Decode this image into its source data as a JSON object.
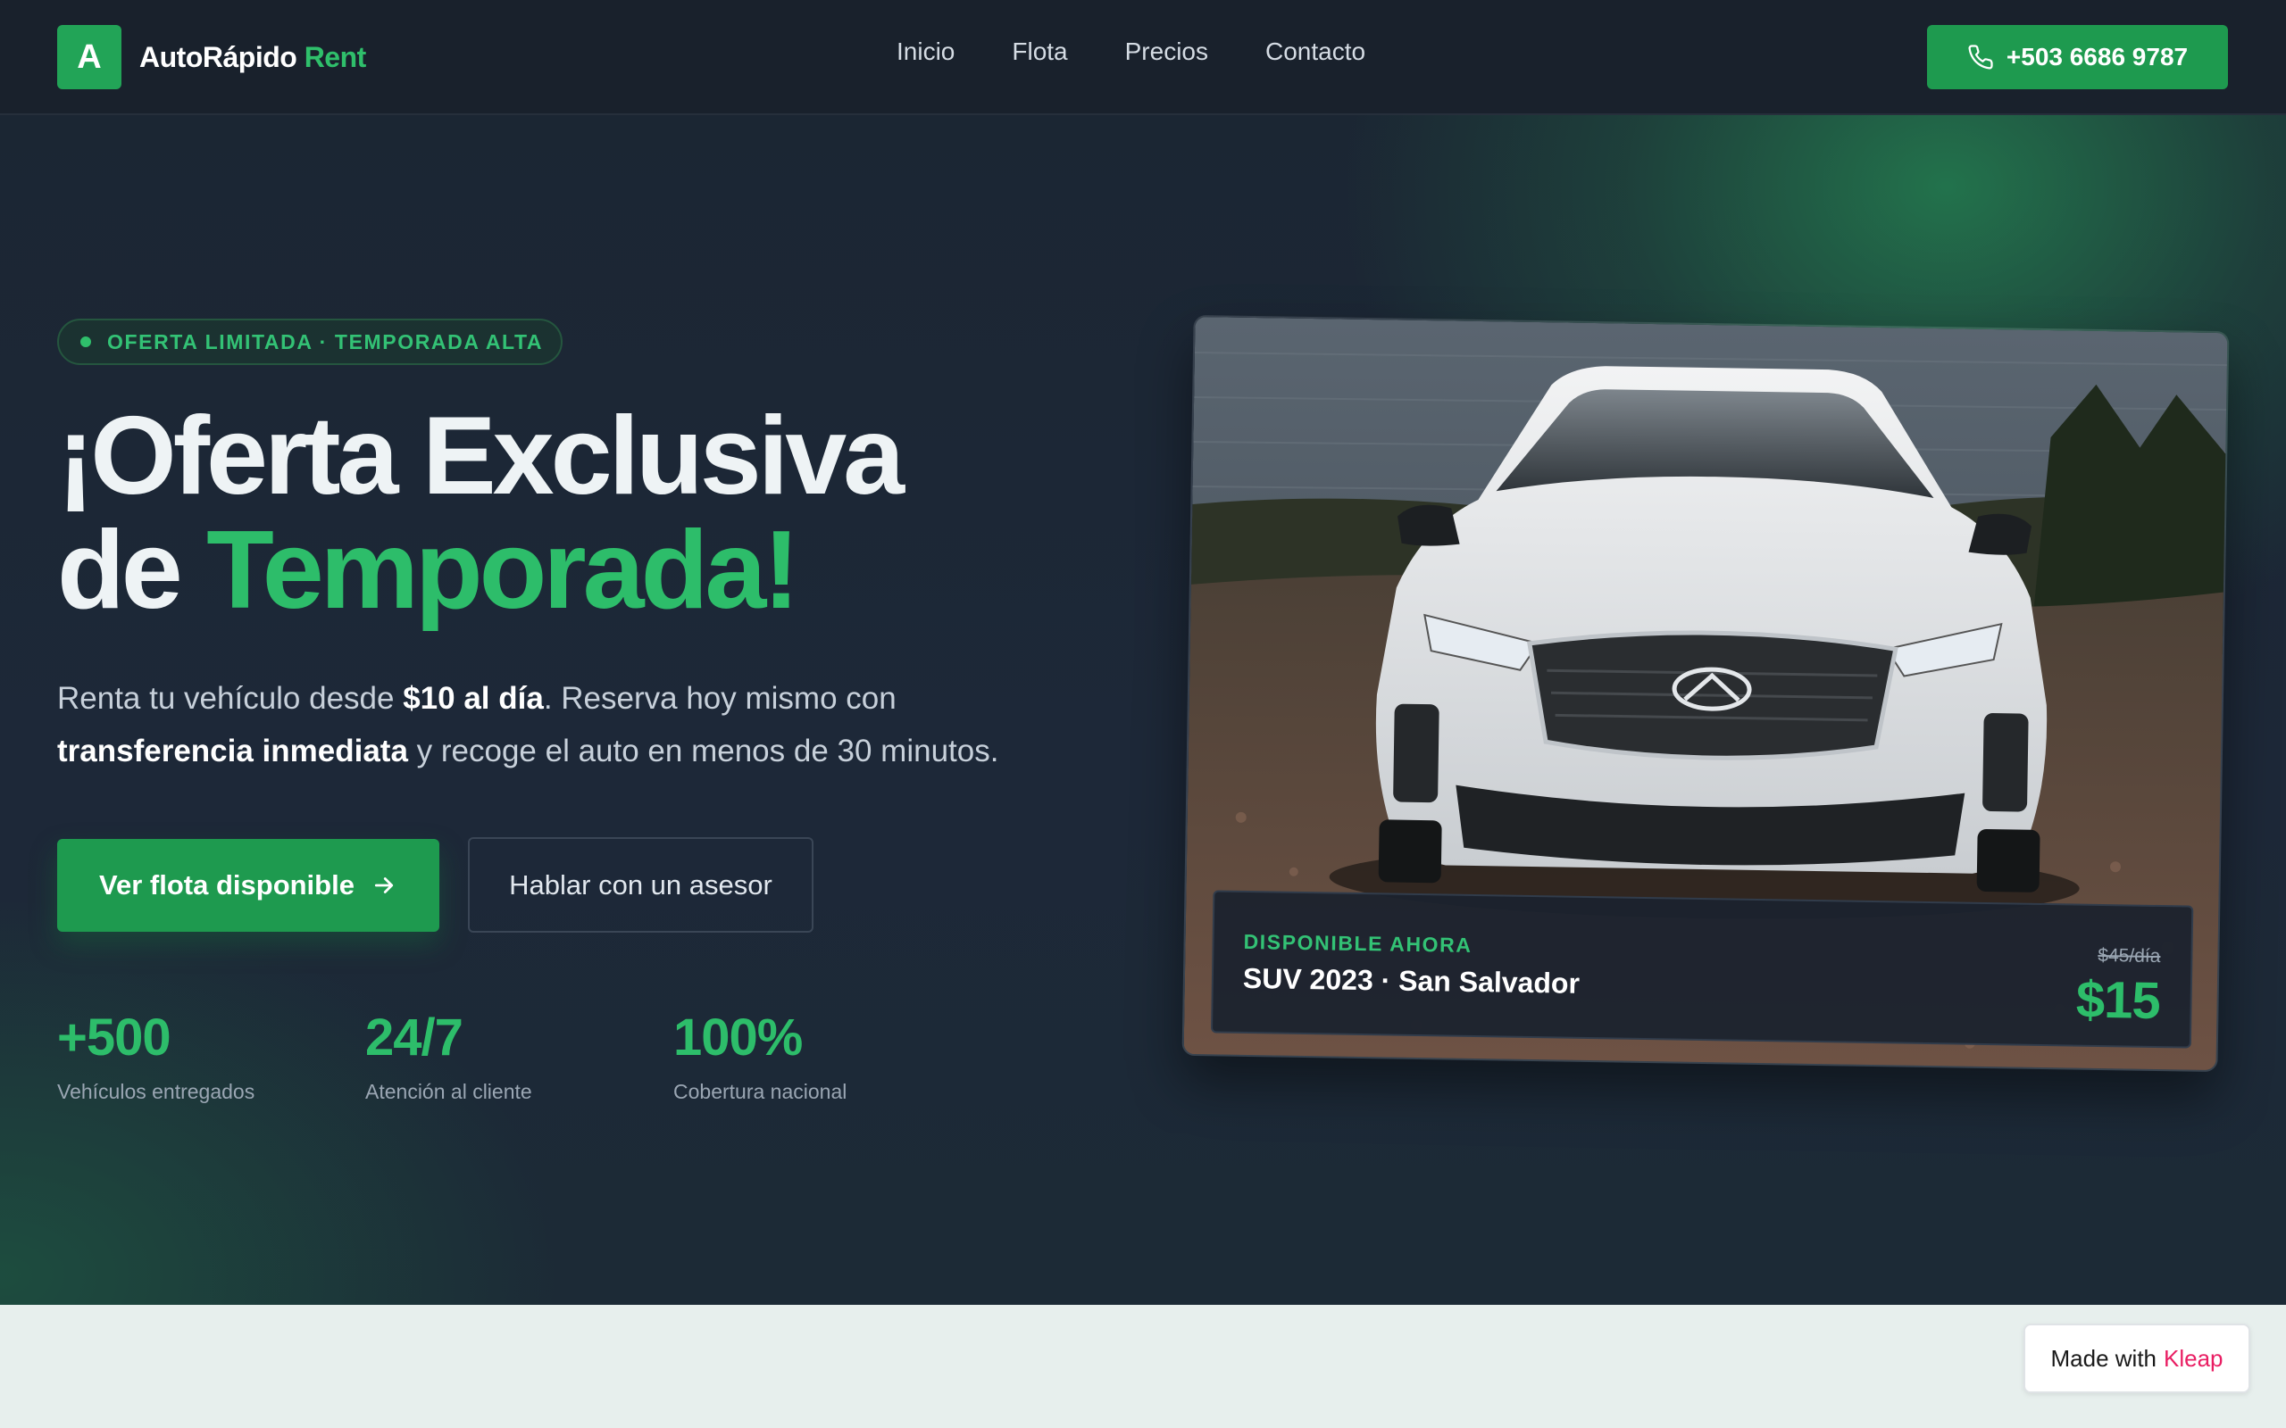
{
  "brand": {
    "mark": "A",
    "name": "AutoRápido",
    "accent": "Rent"
  },
  "nav": {
    "links": [
      "Inicio",
      "Flota",
      "Precios",
      "Contacto"
    ]
  },
  "phone": {
    "label": "+503 6686 9787",
    "icon": "phone-icon"
  },
  "hero": {
    "badge": "OFERTA LIMITADA · TEMPORADA ALTA",
    "headline_line1": "¡Oferta Exclusiva",
    "headline_line2_prefix": "de ",
    "headline_line2_accent": "Temporada!",
    "subtext": {
      "part1": "Renta tu vehículo desde ",
      "bold1": "$10 al día",
      "part2": ". Reserva hoy mismo con ",
      "bold2": "transferencia inmediata",
      "part3": " y recoge el auto en menos de 30 minutos."
    },
    "primary_button": "Ver flota disponible",
    "secondary_button": "Hablar con un asesor",
    "stats": [
      {
        "value": "+500",
        "label": "Vehículos entregados"
      },
      {
        "value": "24/7",
        "label": "Atención al cliente"
      },
      {
        "value": "100%",
        "label": "Cobertura nacional"
      }
    ]
  },
  "car_card": {
    "tag": "DISPONIBLE AHORA",
    "title": "SUV 2023 · San Salvador",
    "old_price": "$45/día",
    "price": "$15"
  },
  "kleap": {
    "prefix": "Made with",
    "brand": "Kleap"
  },
  "colors": {
    "accent": "#2dbd6a",
    "button": "#1e9a4f",
    "nav_bg": "#19212c",
    "footer_bg": "#e7efed",
    "kleap": "#e91e63"
  }
}
